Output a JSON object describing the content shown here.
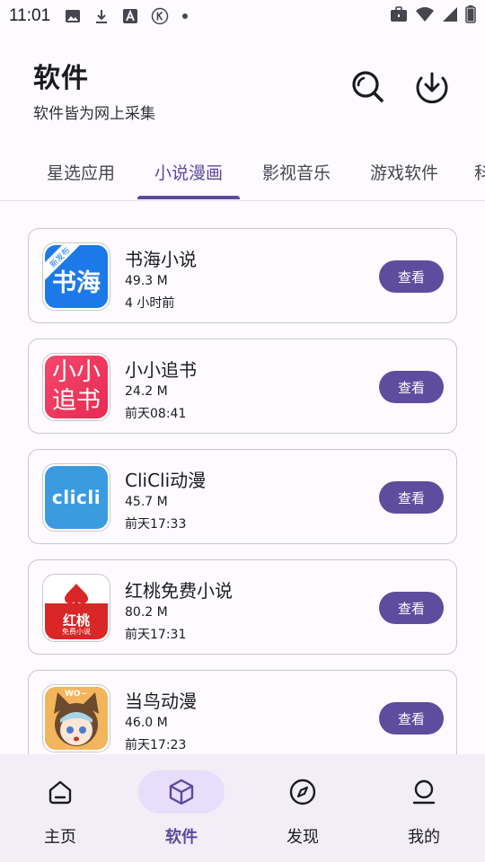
{
  "status_bar": {
    "time": "11:01",
    "left_icons": [
      "image-icon",
      "download-icon",
      "font-a-icon",
      "k-circle-icon",
      "dot-icon"
    ],
    "right_icons": [
      "briefcase-icon",
      "wifi-icon",
      "signal-icon",
      "battery-icon"
    ]
  },
  "header": {
    "title": "软件",
    "subtitle": "软件皆为网上采集"
  },
  "tabs": [
    {
      "label": "星选应用",
      "active": false
    },
    {
      "label": "小说漫画",
      "active": true
    },
    {
      "label": "影视音乐",
      "active": false
    },
    {
      "label": "游戏软件",
      "active": false
    },
    {
      "label": "科",
      "active": false
    }
  ],
  "apps": [
    {
      "name": "书海小说",
      "size": "49.3 M",
      "time": "4 小时前",
      "action": "查看",
      "icon_text": "书海",
      "icon_badge": "新发布",
      "icon_color": "#1877e6"
    },
    {
      "name": "小小追书",
      "size": "24.2 M",
      "time": "前天08:41",
      "action": "查看",
      "icon_text": "小小追书",
      "icon_color": "#f0375b"
    },
    {
      "name": "CliCli动漫",
      "size": "45.7 M",
      "time": "前天17:33",
      "action": "查看",
      "icon_text": "clicli",
      "icon_color": "#3a9be0"
    },
    {
      "name": "红桃免费小说",
      "size": "80.2 M",
      "time": "前天17:31",
      "action": "查看",
      "icon_text": "红桃",
      "icon_subtext": "免费小说",
      "icon_color": "#e02b2b"
    },
    {
      "name": "当鸟动漫",
      "size": "46.0 M",
      "time": "前天17:23",
      "action": "查看",
      "icon_text": "WO~",
      "icon_color": "#f0a040"
    }
  ],
  "bottom_nav": [
    {
      "label": "主页",
      "icon": "home-icon",
      "active": false
    },
    {
      "label": "软件",
      "icon": "cube-icon",
      "active": true
    },
    {
      "label": "发现",
      "icon": "compass-icon",
      "active": false
    },
    {
      "label": "我的",
      "icon": "person-icon",
      "active": false
    }
  ],
  "colors": {
    "accent": "#5a4a9b",
    "button": "#5e4d9e",
    "nav_background": "#f2eef7",
    "nav_active_pill": "#e6defa"
  }
}
